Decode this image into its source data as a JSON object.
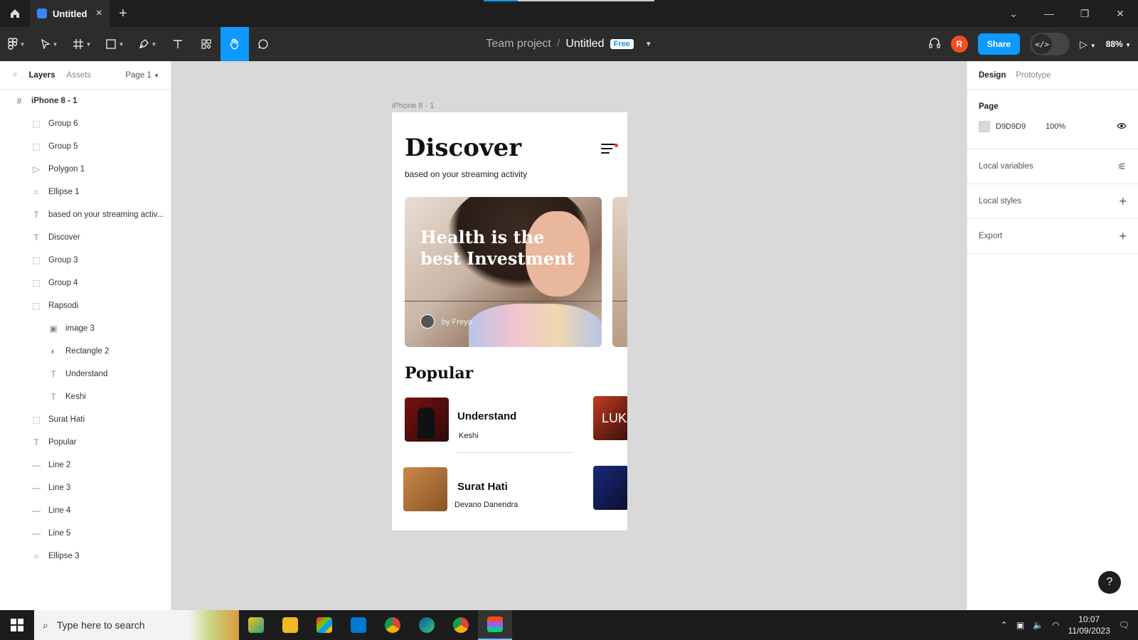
{
  "titlebar": {
    "tab_label": "Untitled",
    "progress_fraction": 0.2,
    "icons": [
      "home-icon",
      "close-icon",
      "plus-icon",
      "chevron-down-icon",
      "minimize-icon",
      "restore-icon",
      "close-window-icon"
    ]
  },
  "toolbar": {
    "crumb_team": "Team project",
    "crumb_separator": "/",
    "crumb_file": "Untitled",
    "plan_badge": "Free",
    "avatar_initial": "R",
    "share_label": "Share",
    "devmode_symbol": "</>",
    "zoom": "88%",
    "active_tool": "hand-tool"
  },
  "left_panel": {
    "tab_layers": "Layers",
    "tab_assets": "Assets",
    "page_selector": "Page 1",
    "layers": [
      {
        "label": "iPhone 8 - 1",
        "icon": "#"
      },
      {
        "label": "Group 6",
        "icon": "⬚"
      },
      {
        "label": "Group 5",
        "icon": "⬚"
      },
      {
        "label": "Polygon 1",
        "icon": "▷"
      },
      {
        "label": "Ellipse 1",
        "icon": "○"
      },
      {
        "label": "based on your streaming activ...",
        "icon": "T"
      },
      {
        "label": "Discover",
        "icon": "T"
      },
      {
        "label": "Group 3",
        "icon": "⬚"
      },
      {
        "label": "Group 4",
        "icon": "⬚"
      },
      {
        "label": "Rapsodi",
        "icon": "⬚"
      },
      {
        "label": "image 3",
        "icon": "▣"
      },
      {
        "label": "Rectangle 2",
        "icon": "◐"
      },
      {
        "label": "Understand",
        "icon": "T"
      },
      {
        "label": "Keshi",
        "icon": "T"
      },
      {
        "label": "Surat Hati",
        "icon": "⬚"
      },
      {
        "label": "Popular",
        "icon": "T"
      },
      {
        "label": "Line 2",
        "icon": "—"
      },
      {
        "label": "Line 3",
        "icon": "—"
      },
      {
        "label": "Line 4",
        "icon": "—"
      },
      {
        "label": "Line 5",
        "icon": "—"
      },
      {
        "label": "Ellipse 3",
        "icon": "○"
      }
    ]
  },
  "canvas": {
    "frame_label": "iPhone 8 - 1",
    "title": "Discover",
    "subtitle": "based on your streaming activity",
    "hero_title": "Health is the best Investment",
    "hero_author": "by Freya",
    "section_popular": "Popular",
    "thumb_3_text": "LUKA",
    "songs": [
      {
        "title": "Understand",
        "artist": "Keshi"
      },
      {
        "title": "Surat Hati",
        "artist": "Devano Danendra"
      }
    ]
  },
  "right_panel": {
    "tab_design": "Design",
    "tab_prototype": "Prototype",
    "page_heading": "Page",
    "page_color": "D9D9D9",
    "page_opacity": "100%",
    "local_variables": "Local variables",
    "local_styles": "Local styles",
    "export": "Export"
  },
  "taskbar": {
    "search_placeholder": "Type here to search",
    "time": "10:07",
    "date": "11/09/2023"
  },
  "colors": {
    "accent": "#0d99ff",
    "canvas_bg": "#d9d9d9",
    "avatar": "#f24e1e"
  }
}
